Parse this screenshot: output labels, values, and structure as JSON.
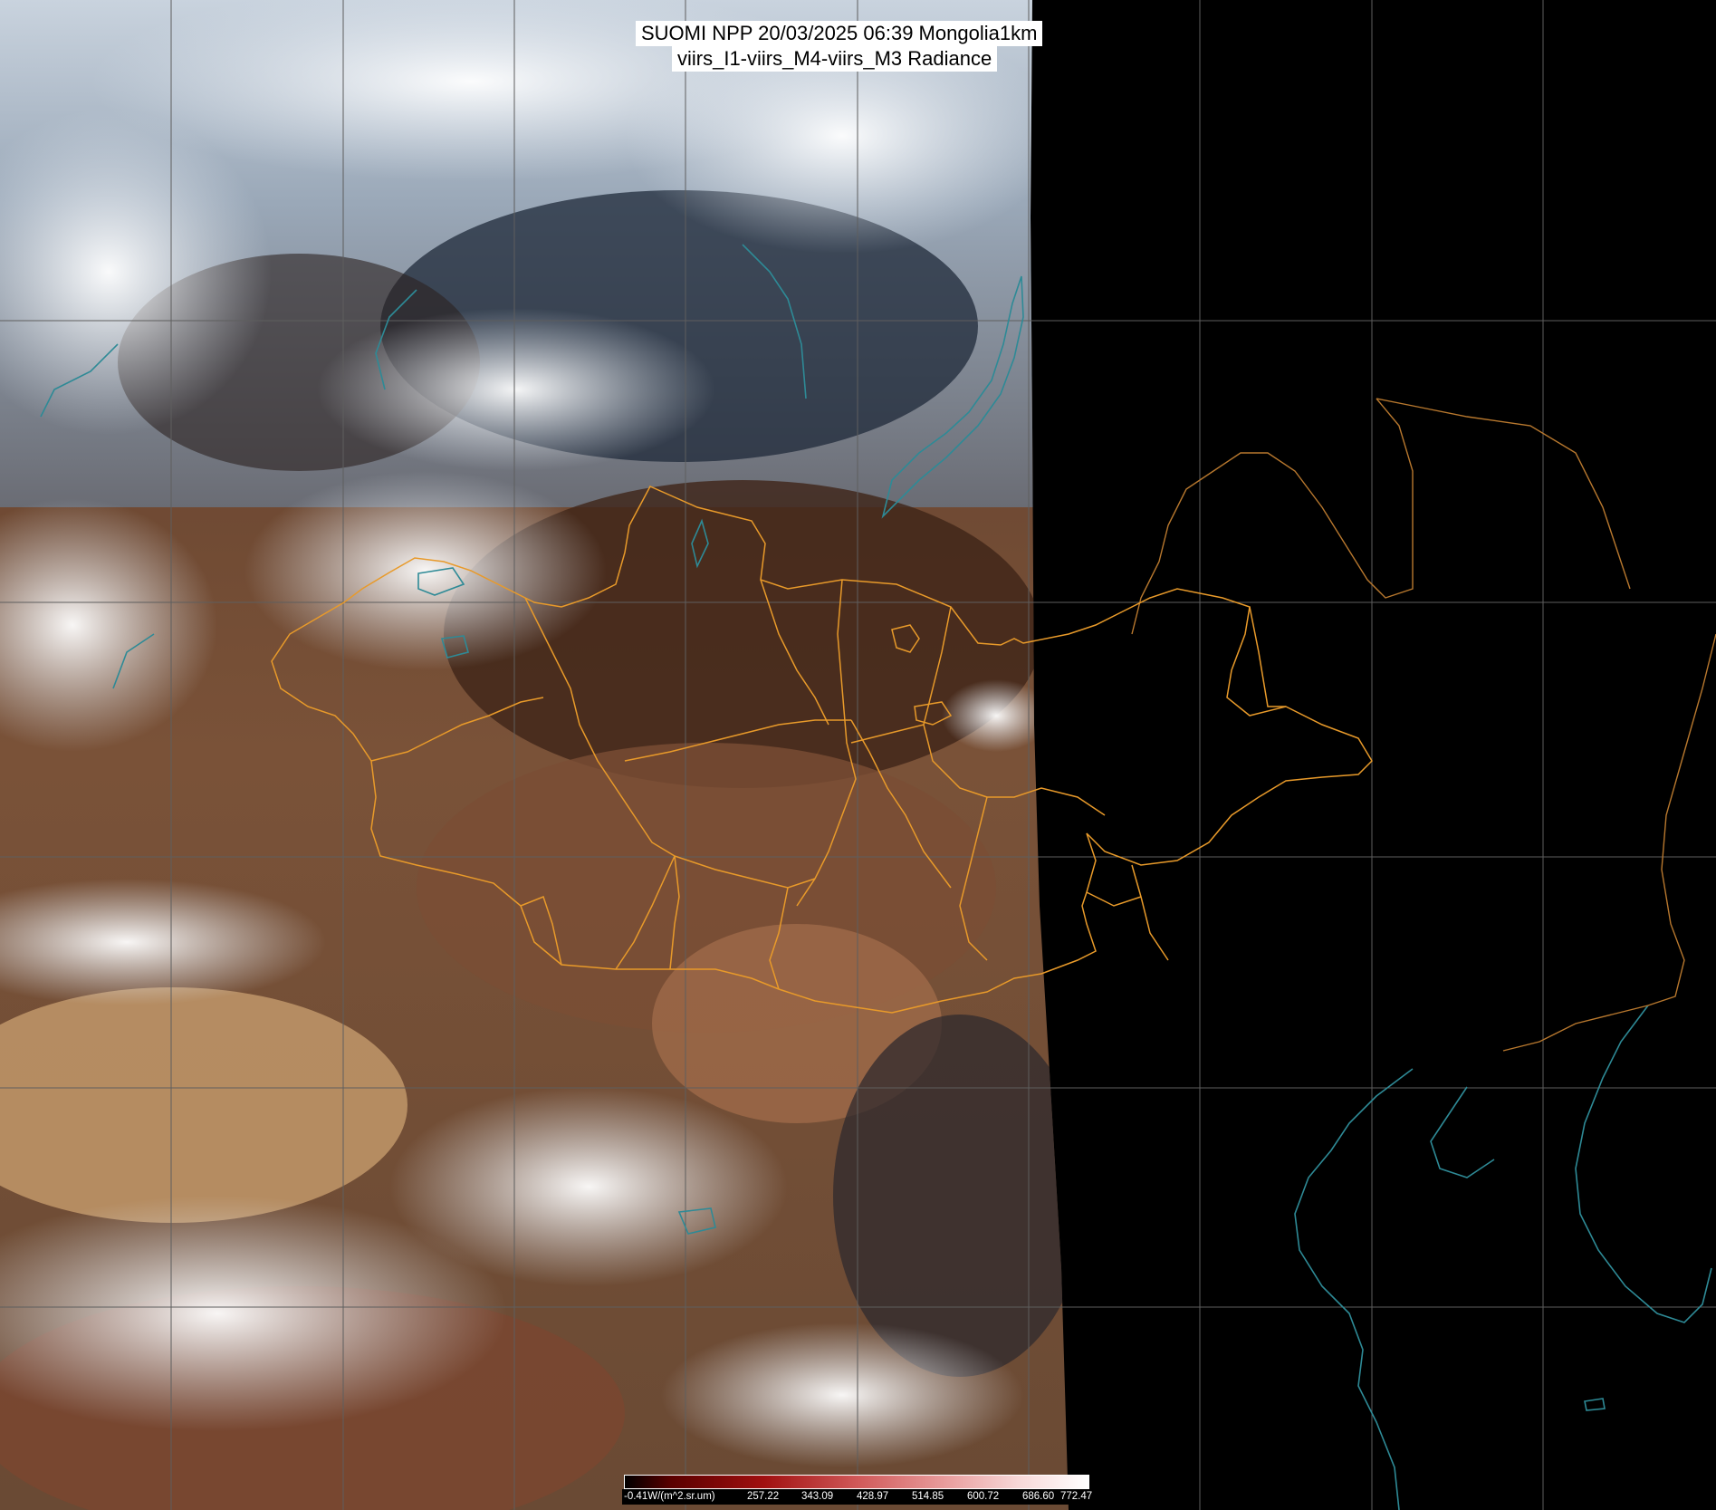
{
  "title": {
    "line1": "SUOMI NPP 20/03/2025 06:39 Mongolia1km",
    "line2": "viirs_I1-viirs_M4-viirs_M3 Radiance"
  },
  "colorbar": {
    "labels": [
      "-0.41W/(m^2.sr.um)",
      "257.22",
      "343.09",
      "428.97",
      "514.85",
      "600.72",
      "686.60",
      "772.47"
    ]
  },
  "colors": {
    "space_background": "#000000",
    "graticule": "#5e5e5e",
    "admin_border": "#e89a2a",
    "country_border": "#b8782e",
    "coastline": "#2e8a96",
    "cloud": "#eef2f6",
    "desert": "#b88f64",
    "land_dark": "#4a2e22"
  }
}
